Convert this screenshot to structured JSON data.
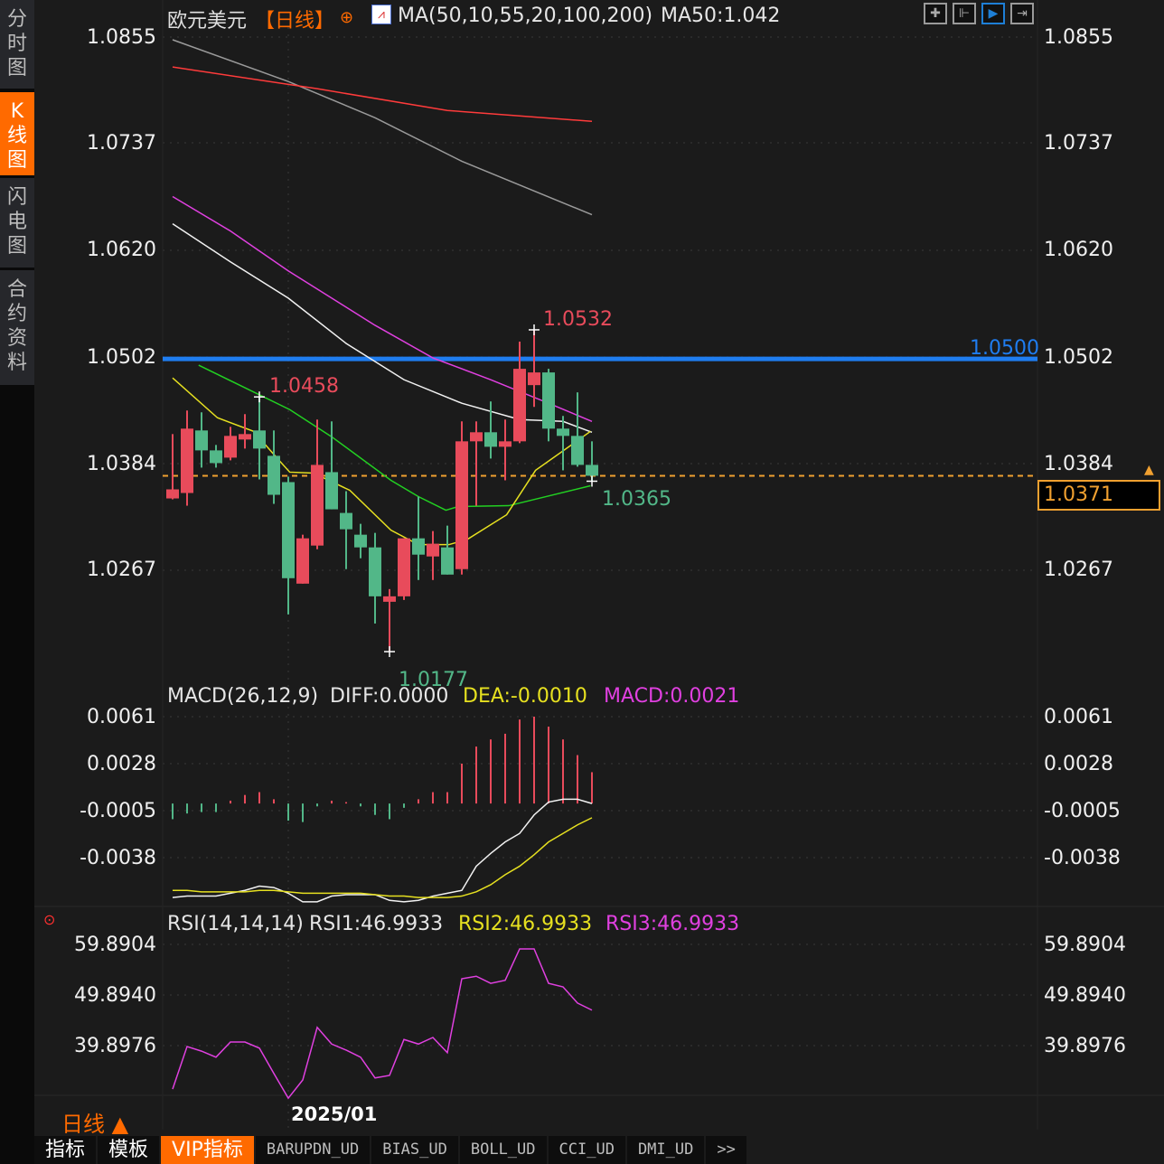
{
  "sidebar": {
    "items": [
      {
        "label": [
          "分",
          "时",
          "图"
        ],
        "active": false
      },
      {
        "label": [
          "K",
          "线",
          "图"
        ],
        "active": true
      },
      {
        "label": [
          "闪",
          "电",
          "图"
        ],
        "active": false
      },
      {
        "label": [
          "合",
          "约",
          "资",
          "料"
        ],
        "active": false
      }
    ]
  },
  "header": {
    "symbol": "欧元美元",
    "period": "【日线】",
    "ma_label": "MA(50,10,55,20,100,200)",
    "ma50_value": "MA50:1.042",
    "toolbar_icons": [
      "crosshair-icon",
      "axis-settings-icon",
      "auto-scroll-icon",
      "move-right-icon"
    ]
  },
  "price_axis": {
    "ticks": [
      "1.0855",
      "1.0737",
      "1.0620",
      "1.0502",
      "1.0384",
      "1.0267"
    ]
  },
  "annotations": {
    "high_label": "1.0532",
    "local_high_label": "1.0458",
    "low_label": "1.0177",
    "last_low_label": "1.0365",
    "horizontal_line_label": "1.0500",
    "current_price": "1.0371"
  },
  "macd": {
    "title": "MACD(26,12,9)",
    "diff_label": "DIFF:0.0000",
    "dea_label": "DEA:-0.0010",
    "macd_label": "MACD:0.0021",
    "ticks": [
      "0.0061",
      "0.0028",
      "-0.0005",
      "-0.0038"
    ]
  },
  "rsi": {
    "title": "RSI(14,14,14)",
    "rsi1_label": "RSI1:46.9933",
    "rsi2_label": "RSI2:46.9933",
    "rsi3_label": "RSI3:46.9933",
    "ticks": [
      "59.8904",
      "49.8940",
      "39.8976"
    ]
  },
  "footer": {
    "period_label": "日线 ▲",
    "date_label": "2025/01",
    "tabs": [
      "指标",
      "模板",
      "VIP指标",
      "BARUPDN_UD",
      "BIAS_UD",
      "BOLL_UD",
      "CCI_UD",
      "DMI_UD",
      ">>"
    ],
    "active_tab": "VIP指标"
  },
  "colors": {
    "up": "#e84b5b",
    "down": "#52b788",
    "accent": "#ff6a00",
    "hline": "#1f7df0"
  },
  "chart_data": {
    "type": "candlestick",
    "ylim": [
      1.015,
      1.086
    ],
    "hline": 1.05,
    "current": 1.0371,
    "ohlc": [
      [
        1.0346,
        1.0417,
        1.0345,
        1.0356
      ],
      [
        1.0352,
        1.0443,
        1.0338,
        1.0423
      ],
      [
        1.0421,
        1.0441,
        1.038,
        1.0399
      ],
      [
        1.0399,
        1.0405,
        1.038,
        1.0385
      ],
      [
        1.0391,
        1.0425,
        1.0388,
        1.0415
      ],
      [
        1.0411,
        1.0439,
        1.0401,
        1.0417
      ],
      [
        1.0421,
        1.0458,
        1.0367,
        1.0401
      ],
      [
        1.0393,
        1.0421,
        1.034,
        1.035
      ],
      [
        1.0364,
        1.037,
        1.0218,
        1.0258
      ],
      [
        1.0252,
        1.0306,
        1.0252,
        1.0302
      ],
      [
        1.0294,
        1.0433,
        1.029,
        1.0383
      ],
      [
        1.0375,
        1.0431,
        1.0334,
        1.0334
      ],
      [
        1.033,
        1.0354,
        1.0268,
        1.0312
      ],
      [
        1.0306,
        1.0318,
        1.028,
        1.0292
      ],
      [
        1.0292,
        1.0308,
        1.0208,
        1.0238
      ],
      [
        1.0232,
        1.0246,
        1.0177,
        1.0238
      ],
      [
        1.0238,
        1.0302,
        1.0234,
        1.0302
      ],
      [
        1.0302,
        1.0348,
        1.0256,
        1.0284
      ],
      [
        1.0282,
        1.031,
        1.0256,
        1.0296
      ],
      [
        1.0292,
        1.0316,
        1.0262,
        1.0262
      ],
      [
        1.0268,
        1.0431,
        1.0262,
        1.0409
      ],
      [
        1.0409,
        1.0431,
        1.0338,
        1.0419
      ],
      [
        1.0419,
        1.0453,
        1.039,
        1.0403
      ],
      [
        1.0403,
        1.0433,
        1.0366,
        1.0409
      ],
      [
        1.0409,
        1.0519,
        1.0407,
        1.0489
      ],
      [
        1.0471,
        1.0532,
        1.0447,
        1.0485
      ],
      [
        1.0485,
        1.0489,
        1.0409,
        1.0423
      ],
      [
        1.0423,
        1.0437,
        1.0377,
        1.0415
      ],
      [
        1.0415,
        1.0463,
        1.0381,
        1.0383
      ],
      [
        1.0383,
        1.0409,
        1.0365,
        1.0371
      ]
    ],
    "ma_lines": [
      {
        "name": "MA200",
        "color": "#9a9a9a",
        "points": [
          [
            0,
            1.0852
          ],
          [
            8,
            1.0806
          ],
          [
            14,
            1.0766
          ],
          [
            20,
            1.0718
          ],
          [
            29,
            1.0659
          ]
        ]
      },
      {
        "name": "MA100",
        "color": "#ff3b3b",
        "points": [
          [
            0,
            1.0822
          ],
          [
            10,
            1.0798
          ],
          [
            19,
            1.0774
          ],
          [
            29,
            1.0762
          ]
        ]
      },
      {
        "name": "MA55",
        "color": "#e040e0",
        "points": [
          [
            0,
            1.0679
          ],
          [
            4,
            1.0641
          ],
          [
            8,
            1.0597
          ],
          [
            14,
            1.0537
          ],
          [
            18,
            1.0501
          ],
          [
            22,
            1.0477
          ],
          [
            26,
            1.0451
          ],
          [
            29,
            1.0431
          ]
        ]
      },
      {
        "name": "MA50",
        "color": "#f2f2f2",
        "points": [
          [
            0,
            1.0649
          ],
          [
            4,
            1.0607
          ],
          [
            8,
            1.0567
          ],
          [
            12,
            1.0517
          ],
          [
            16,
            1.0477
          ],
          [
            20,
            1.0451
          ],
          [
            24,
            1.0433
          ],
          [
            27,
            1.0431
          ],
          [
            29,
            1.0419
          ]
        ]
      },
      {
        "name": "MA20",
        "color": "#22d022",
        "points": [
          [
            1.8,
            1.0493
          ],
          [
            8.1,
            1.0444
          ],
          [
            11,
            1.0414
          ],
          [
            15.1,
            1.0366
          ],
          [
            17,
            1.0348
          ],
          [
            18.9,
            1.0333
          ],
          [
            19.75,
            1.0337
          ],
          [
            23.25,
            1.0338
          ],
          [
            28.9,
            1.036
          ]
        ]
      },
      {
        "name": "MA10",
        "color": "#e6e020",
        "points": [
          [
            0,
            1.0479
          ],
          [
            3.1,
            1.0435
          ],
          [
            5.6,
            1.042
          ],
          [
            7.25,
            1.039
          ],
          [
            8.1,
            1.0375
          ],
          [
            9.75,
            1.0374
          ],
          [
            12.25,
            1.0355
          ],
          [
            15.1,
            1.0311
          ],
          [
            17,
            1.0295
          ],
          [
            19.1,
            1.0295
          ],
          [
            20.4,
            1.0301
          ],
          [
            23.1,
            1.0328
          ],
          [
            25.1,
            1.0377
          ],
          [
            28.9,
            1.042
          ]
        ]
      }
    ],
    "macd": {
      "hist": [
        -0.0011,
        -0.0007,
        -0.0006,
        -0.0006,
        0.0002,
        0.0006,
        0.0008,
        0.0003,
        -0.0012,
        -0.0013,
        -0.0002,
        0.0002,
        0.0001,
        -0.0002,
        -0.0008,
        -0.0011,
        -0.0003,
        0.0003,
        0.0008,
        0.0008,
        0.0028,
        0.004,
        0.0045,
        0.0049,
        0.0059,
        0.0061,
        0.0054,
        0.0045,
        0.0034,
        0.0022
      ],
      "diff": [
        -0.0066,
        -0.0065,
        -0.0065,
        -0.0065,
        -0.0063,
        -0.0061,
        -0.0058,
        -0.0059,
        -0.0063,
        -0.0069,
        -0.0069,
        -0.0065,
        -0.0064,
        -0.0064,
        -0.0064,
        -0.0068,
        -0.0069,
        -0.0068,
        -0.0065,
        -0.0063,
        -0.0061,
        -0.0044,
        -0.0035,
        -0.0027,
        -0.0021,
        -0.0008,
        0.0001,
        0.0003,
        0.0003,
        0.0
      ],
      "dea": [
        -0.0061,
        -0.0061,
        -0.0062,
        -0.0062,
        -0.0062,
        -0.0062,
        -0.0061,
        -0.0061,
        -0.0062,
        -0.0063,
        -0.0063,
        -0.0063,
        -0.0063,
        -0.0063,
        -0.0064,
        -0.0065,
        -0.0065,
        -0.0066,
        -0.0066,
        -0.0066,
        -0.0065,
        -0.0062,
        -0.0057,
        -0.005,
        -0.0044,
        -0.0036,
        -0.0027,
        -0.0021,
        -0.0015,
        -0.001
      ]
    },
    "rsi": [
      31.3,
      39.7,
      38.8,
      37.6,
      40.6,
      40.6,
      39.4,
      34.4,
      29.5,
      33.1,
      43.5,
      40.2,
      39.0,
      37.6,
      33.5,
      34.0,
      41.1,
      40.2,
      41.5,
      38.5,
      53.1,
      53.6,
      52.2,
      52.8,
      59.0,
      59.0,
      52.2,
      51.5,
      48.3,
      46.9
    ]
  }
}
